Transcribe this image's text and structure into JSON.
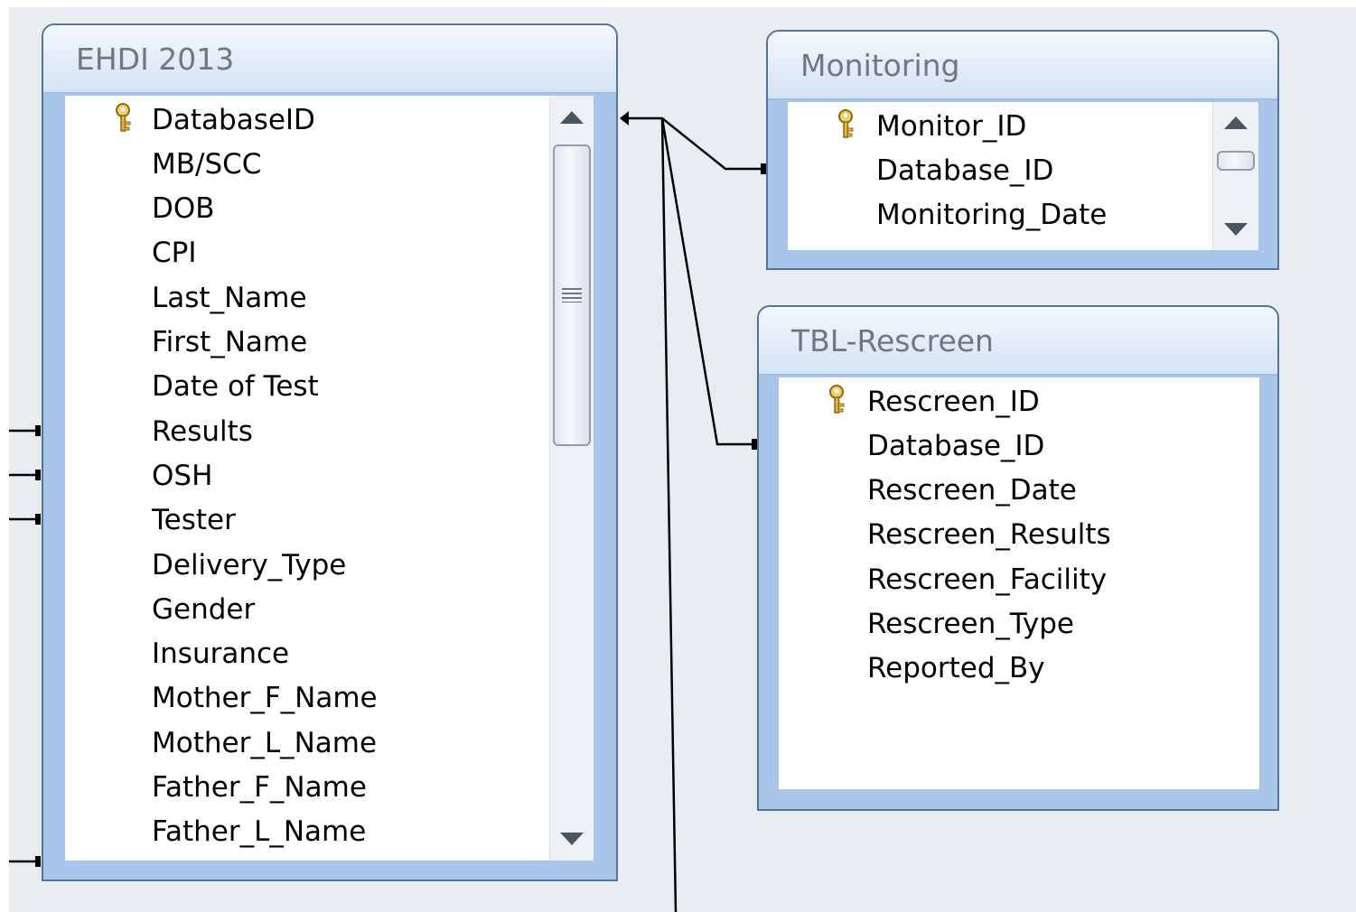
{
  "tables": {
    "ehdi": {
      "title": "EHDI 2013",
      "fields": [
        "DatabaseID",
        "MB/SCC",
        "DOB",
        "CPI",
        "Last_Name",
        "First_Name",
        "Date of Test",
        "Results",
        "OSH",
        "Tester",
        "Delivery_Type",
        "Gender",
        "Insurance",
        "Mother_F_Name",
        "Mother_L_Name",
        "Father_F_Name",
        "Father_L_Name"
      ],
      "primary_key": "DatabaseID"
    },
    "monitoring": {
      "title": "Monitoring",
      "fields": [
        "Monitor_ID",
        "Database_ID",
        "Monitoring_Date"
      ],
      "primary_key": "Monitor_ID"
    },
    "rescreen": {
      "title": "TBL-Rescreen",
      "fields": [
        "Rescreen_ID",
        "Database_ID",
        "Rescreen_Date",
        "Rescreen_Results",
        "Rescreen_Facility",
        "Rescreen_Type",
        "Reported_By"
      ],
      "primary_key": "Rescreen_ID"
    }
  },
  "icons": {
    "key": "key-icon",
    "scroll_up": "scroll-up-arrow-icon",
    "scroll_down": "scroll-down-arrow-icon",
    "grip": "scroll-grip-icon"
  },
  "colors": {
    "canvas": "#e9edf1",
    "table_frame": "#a9c6ea",
    "table_border": "#56739b",
    "title_text": "#707780",
    "relationship_line": "#000000"
  }
}
